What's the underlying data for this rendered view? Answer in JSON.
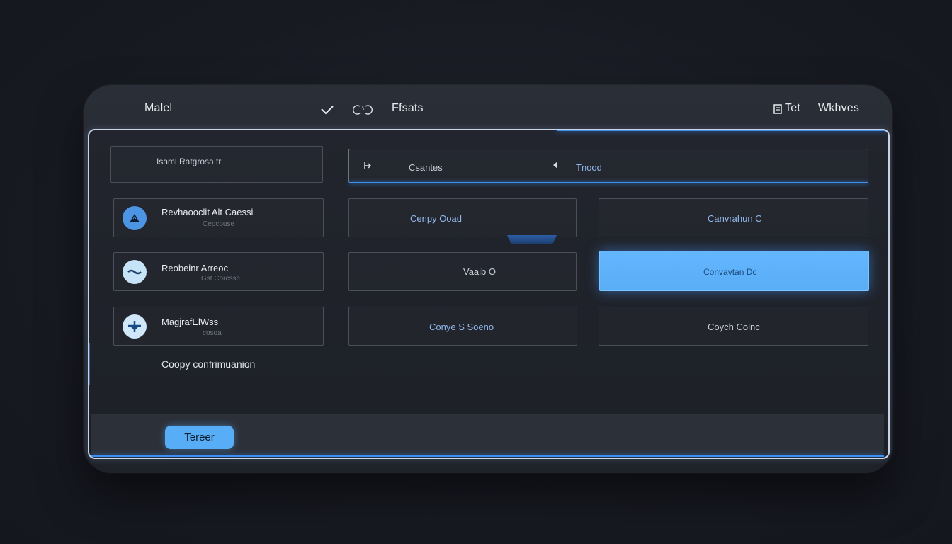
{
  "titlebar": {
    "title": "Malel",
    "center_label": "Ffsats",
    "right_label_1": "Tet",
    "right_label_2": "Wkhves"
  },
  "search": {
    "left_placeholder": "Isaml Ratgrosa tr",
    "main_label_1": "Csantes",
    "main_label_2": "Tnood"
  },
  "contacts": [
    {
      "name": "Revhaooclit Alt Caessi",
      "subtitle": "Cepcouse",
      "avatar_icon": "mountain-icon"
    },
    {
      "name": "Reobeinr Arreoc",
      "subtitle": "Gst Corcsse",
      "avatar_icon": "wave-icon"
    },
    {
      "name": "MagjrafElWss",
      "subtitle": "cosoa",
      "avatar_icon": "ship-icon"
    }
  ],
  "footer_note": "Coopy confrimuanion",
  "grid": {
    "row1": [
      "Cenpy Ooad",
      "Canvrahun C"
    ],
    "row2": [
      "Vaaib O",
      "Convavtan Dc"
    ],
    "row3": [
      "Conye S Soeno",
      "Coych Colnc"
    ]
  },
  "footer": {
    "primary_button": "Tereer"
  },
  "colors": {
    "accent": "#3d8ff2",
    "selected": "#5aaef5",
    "background": "#181a22"
  }
}
